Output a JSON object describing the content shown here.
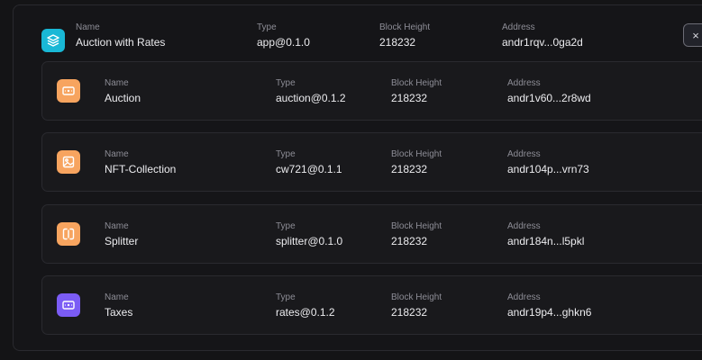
{
  "labels": {
    "name": "Name",
    "type": "Type",
    "block_height": "Block Height",
    "address": "Address"
  },
  "app": {
    "name": "Auction with Rates",
    "type": "app@0.1.0",
    "block_height": "218232",
    "address": "andr1rqv...0ga2d",
    "icon": "layers-icon",
    "color": "#19b8d6"
  },
  "close_glyph": "×",
  "components": [
    {
      "name": "Auction",
      "type": "auction@0.1.2",
      "block_height": "218232",
      "address": "andr1v60...2r8wd",
      "icon": "ticket-icon",
      "color": "#f7a45f"
    },
    {
      "name": "NFT-Collection",
      "type": "cw721@0.1.1",
      "block_height": "218232",
      "address": "andr104p...vrn73",
      "icon": "image-icon",
      "color": "#f7a45f"
    },
    {
      "name": "Splitter",
      "type": "splitter@0.1.0",
      "block_height": "218232",
      "address": "andr184n...l5pkl",
      "icon": "split-icon",
      "color": "#f7a45f"
    },
    {
      "name": "Taxes",
      "type": "rates@0.1.2",
      "block_height": "218232",
      "address": "andr19p4...ghkn6",
      "icon": "ticket-icon",
      "color": "#7b5cf5"
    }
  ]
}
